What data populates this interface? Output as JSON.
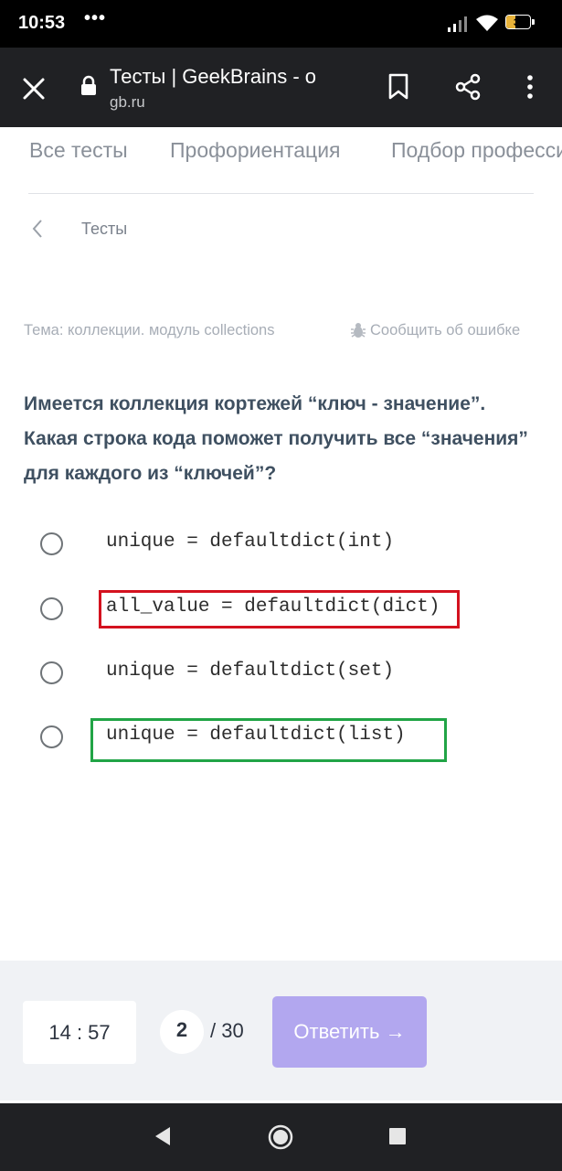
{
  "status_bar": {
    "time": "10:53",
    "dots": "•••",
    "battery_percent": 39,
    "battery_label": "39"
  },
  "browser": {
    "title": "Тесты | GeekBrains - о",
    "url": "gb.ru"
  },
  "nav": {
    "items": [
      "Все тесты",
      "Профориентация",
      "Подбор профессии"
    ]
  },
  "breadcrumb": {
    "label": "Тесты"
  },
  "meta": {
    "topic": "Тема: коллекции. модуль collections",
    "report": "Сообщить об ошибке"
  },
  "question": {
    "text": "Имеется коллекция кортежей “ключ - значение”. Какая строка кода поможет получить все “значения” для каждого из “ключей”?"
  },
  "options": [
    {
      "code": "unique = defaultdict(int)"
    },
    {
      "code": "all_value = defaultdict(dict)"
    },
    {
      "code": "unique = defaultdict(set)"
    },
    {
      "code": "unique = defaultdict(list)"
    }
  ],
  "footer": {
    "timer": "14 : 57",
    "current": "2",
    "total": "/ 30",
    "answer_label": "Ответить →"
  },
  "colors": {
    "accent_button": "#b2a7ef",
    "highlight_red": "#d4121f",
    "highlight_green": "#21a446",
    "question_text": "#3f5061"
  }
}
